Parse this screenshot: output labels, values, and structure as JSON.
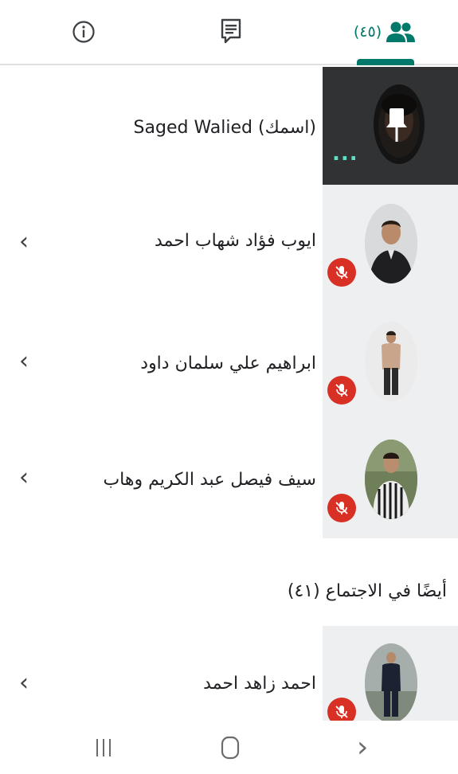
{
  "tabs": {
    "people_count": "(٤٥)",
    "accent_color": "#00796b"
  },
  "self": {
    "name": "Saged Walied (اسمك)",
    "more_dots": "..."
  },
  "participants": [
    {
      "name": "ايوب فؤاد شهاب احمد",
      "chevron": "‹",
      "muted": true
    },
    {
      "name": "ابراهيم علي سلمان داود",
      "chevron": "‹",
      "muted": true
    },
    {
      "name": "سيف فيصل عبد الكريم وهاب",
      "chevron": "‹",
      "muted": true
    }
  ],
  "also_in_meeting": {
    "title": "أيضًا في الاجتماع (٤١)",
    "participants": [
      {
        "name": "احمد زاهد احمد",
        "chevron": "‹",
        "muted": true
      }
    ]
  },
  "nav": {
    "back": "‹"
  },
  "icons": {
    "info": "info-icon",
    "chat": "chat-icon",
    "people": "people-icon",
    "pin": "pin-icon",
    "mic_off": "mic-off-icon",
    "recents": "recents-icon",
    "home": "home-icon"
  }
}
